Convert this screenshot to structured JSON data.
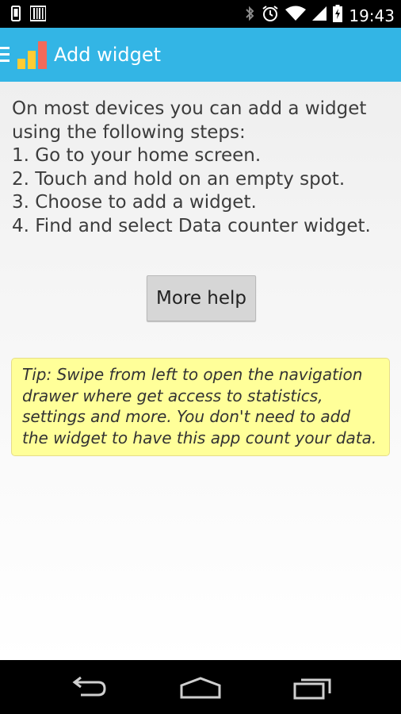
{
  "status_bar": {
    "time": "19:43",
    "left_icons": [
      "phone-icon",
      "barcode-icon"
    ],
    "right_icons": [
      "bluetooth-icon",
      "alarm-icon",
      "wifi-icon",
      "signal-icon",
      "battery-charging-icon"
    ]
  },
  "action_bar": {
    "title": "Add widget",
    "color": "#33b5e5",
    "icons": [
      "menu-icon",
      "app-logo-icon"
    ]
  },
  "instructions": {
    "lines": [
      "On most devices you can add a widget",
      "using the following steps:",
      "1. Go to your home screen.",
      "2. Touch and hold on an empty spot.",
      "3. Choose to add a widget.",
      "4. Find and select Data counter widget."
    ]
  },
  "more_help_button": {
    "label": "More help"
  },
  "tip": {
    "text": "Tip: Swipe from left to open the navigation drawer where get access to statistics, settings and more. You don't need to add the widget to have this app count your data.",
    "background": "#ffff99"
  },
  "nav_bar": {
    "buttons": [
      "back-icon",
      "home-icon",
      "recents-icon"
    ]
  }
}
